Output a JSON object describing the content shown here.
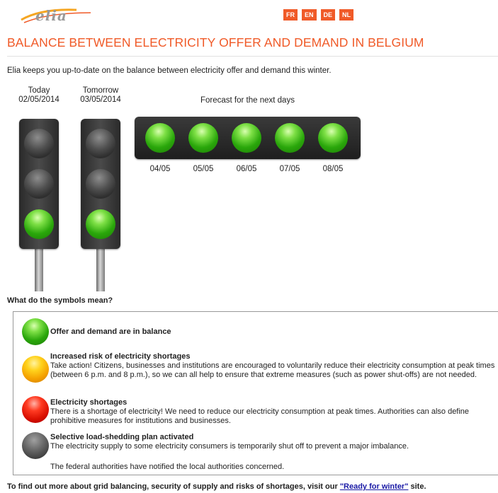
{
  "header": {
    "logo_text": "elia",
    "languages": [
      "FR",
      "EN",
      "DE",
      "NL"
    ]
  },
  "page": {
    "title": "BALANCE BETWEEN ELECTRICITY OFFER AND DEMAND IN BELGIUM",
    "intro": "Elia keeps you up-to-date on the balance between electricity offer and demand this winter."
  },
  "today": {
    "label": "Today",
    "date": "02/05/2014",
    "lights": [
      "off",
      "off",
      "green"
    ]
  },
  "tomorrow": {
    "label": "Tomorrow",
    "date": "03/05/2014",
    "lights": [
      "off",
      "off",
      "green"
    ]
  },
  "forecast": {
    "title": "Forecast for the next days",
    "days": [
      {
        "date": "04/05",
        "status": "green"
      },
      {
        "date": "05/05",
        "status": "green"
      },
      {
        "date": "06/05",
        "status": "green"
      },
      {
        "date": "07/05",
        "status": "green"
      },
      {
        "date": "08/05",
        "status": "green"
      }
    ]
  },
  "legend": {
    "heading": "What do the symbols mean?",
    "items": [
      {
        "color": "green",
        "title": "Offer and demand are in balance",
        "text": ""
      },
      {
        "color": "amber",
        "title": "Increased risk of electricity shortages",
        "text": "Take action! Citizens, businesses and institutions are encouraged to voluntarily reduce their electricity consumption at peak times (between 6 p.m. and 8 p.m.), so we can all help to ensure that extreme measures (such as power shut-offs) are not needed."
      },
      {
        "color": "red",
        "title": "Electricity shortages",
        "text": "There is a shortage of electricity! We need to reduce our electricity consumption at peak times. Authorities can also define prohibitive measures for institutions and businesses."
      },
      {
        "color": "grey",
        "title": "Selective load-shedding plan activated",
        "text": "The electricity supply to some electricity consumers is temporarily shut off to prevent a major imbalance."
      }
    ],
    "note": "The federal authorities have notified the local authorities concerned."
  },
  "footer": {
    "prefix": "To find out more about grid balancing, security of supply and risks of shortages, visit our ",
    "link": "\"Ready for winter\"",
    "suffix": " site."
  }
}
